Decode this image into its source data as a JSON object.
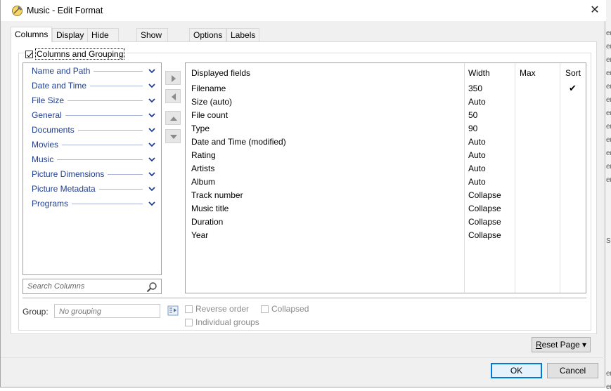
{
  "window": {
    "title": "Music - Edit Format",
    "close_glyph": "✕"
  },
  "tabs": [
    {
      "label": "Columns",
      "active": true
    },
    {
      "label": "Display"
    },
    {
      "label": "Hide Filters"
    },
    {
      "label": "Show Filters"
    },
    {
      "label": "Options"
    },
    {
      "label": "Labels"
    }
  ],
  "group": {
    "label": "Columns and Grouping",
    "checked": true
  },
  "categories": [
    "Name and Path",
    "Date and Time",
    "File Size",
    "General",
    "Documents",
    "Movies",
    "Music",
    "Picture Dimensions",
    "Picture Metadata",
    "Programs"
  ],
  "search": {
    "placeholder": "Search Columns"
  },
  "fields_table": {
    "headers": {
      "name": "Displayed fields",
      "width": "Width",
      "max": "Max",
      "sort": "Sort"
    },
    "rows": [
      {
        "name": "Filename",
        "width": "350",
        "sort": "✔"
      },
      {
        "name": "Size (auto)",
        "width": "Auto"
      },
      {
        "name": "File count",
        "width": "50"
      },
      {
        "name": "Type",
        "width": "90"
      },
      {
        "name": "Date and Time (modified)",
        "width": "Auto"
      },
      {
        "name": "Rating",
        "width": "Auto"
      },
      {
        "name": "Artists",
        "width": "Auto"
      },
      {
        "name": "Album",
        "width": "Auto"
      },
      {
        "name": "Track number",
        "width": "Collapse"
      },
      {
        "name": "Music title",
        "width": "Collapse"
      },
      {
        "name": "Duration",
        "width": "Collapse"
      },
      {
        "name": "Year",
        "width": "Collapse"
      }
    ]
  },
  "grouping": {
    "label": "Group:",
    "placeholder": "No grouping",
    "reverse_order": "Reverse order",
    "collapsed": "Collapsed",
    "individual_groups": "Individual groups"
  },
  "buttons": {
    "reset_label_u": "R",
    "reset_label_rest": "eset Page",
    "reset_caret": "▾",
    "ok": "OK",
    "cancel": "Cancel"
  },
  "background_strip": [
    "er",
    "er",
    "er",
    "er",
    "er",
    "er",
    "er",
    "er",
    "er",
    "er",
    "er",
    "er",
    "S",
    "er",
    "er"
  ]
}
